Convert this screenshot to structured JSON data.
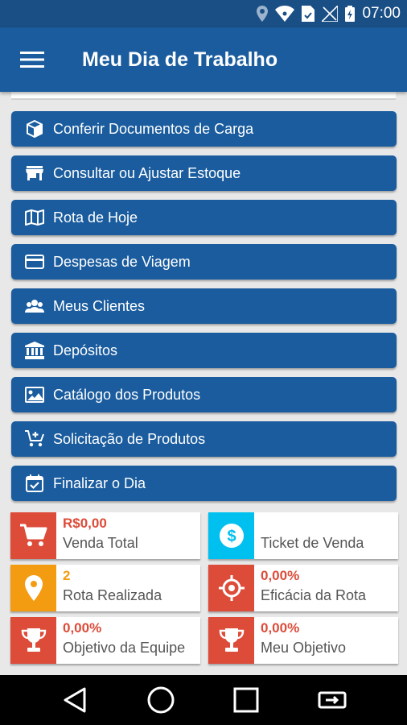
{
  "status_bar": {
    "time": "07:00"
  },
  "app_bar": {
    "title": "Meu Dia de Trabalho"
  },
  "menu": {
    "items": [
      {
        "label": "Conferir Documentos de Carga",
        "icon": "box-icon"
      },
      {
        "label": "Consultar ou Ajustar Estoque",
        "icon": "store-icon"
      },
      {
        "label": "Rota de Hoje",
        "icon": "map-icon"
      },
      {
        "label": "Despesas de Viagem",
        "icon": "credit-card-icon"
      },
      {
        "label": "Meus Clientes",
        "icon": "users-icon"
      },
      {
        "label": "Depósitos",
        "icon": "bank-icon"
      },
      {
        "label": "Catálogo dos Produtos",
        "icon": "image-icon"
      },
      {
        "label": "Solicitação de Produtos",
        "icon": "cart-plus-icon"
      },
      {
        "label": "Finalizar o Dia",
        "icon": "calendar-check-icon"
      }
    ]
  },
  "cards": [
    {
      "value": "R$0,00",
      "label": "Venda Total",
      "icon": "cart-icon",
      "color": "#dd4b39",
      "value_color": "#dd4b39"
    },
    {
      "value": "",
      "label": "Ticket de Venda",
      "icon": "dollar-icon",
      "color": "#00c0ef",
      "value_color": "#dd4b39"
    },
    {
      "value": "2",
      "label": "Rota Realizada",
      "icon": "map-marker-icon",
      "color": "#f39c12",
      "value_color": "#f39c12"
    },
    {
      "value": "0,00%",
      "label": "Eficácia da Rota",
      "icon": "crosshair-icon",
      "color": "#dd4b39",
      "value_color": "#dd4b39"
    },
    {
      "value": "0,00%",
      "label": "Objetivo da Equipe",
      "icon": "trophy-icon",
      "color": "#dd4b39",
      "value_color": "#dd4b39"
    },
    {
      "value": "0,00%",
      "label": "Meu Objetivo",
      "icon": "trophy-icon",
      "color": "#dd4b39",
      "value_color": "#dd4b39"
    }
  ],
  "colors": {
    "primary": "#1a5c9e",
    "status_bar": "#1a4f86",
    "accent_red": "#dd4b39",
    "accent_cyan": "#00c0ef",
    "accent_orange": "#f39c12"
  }
}
